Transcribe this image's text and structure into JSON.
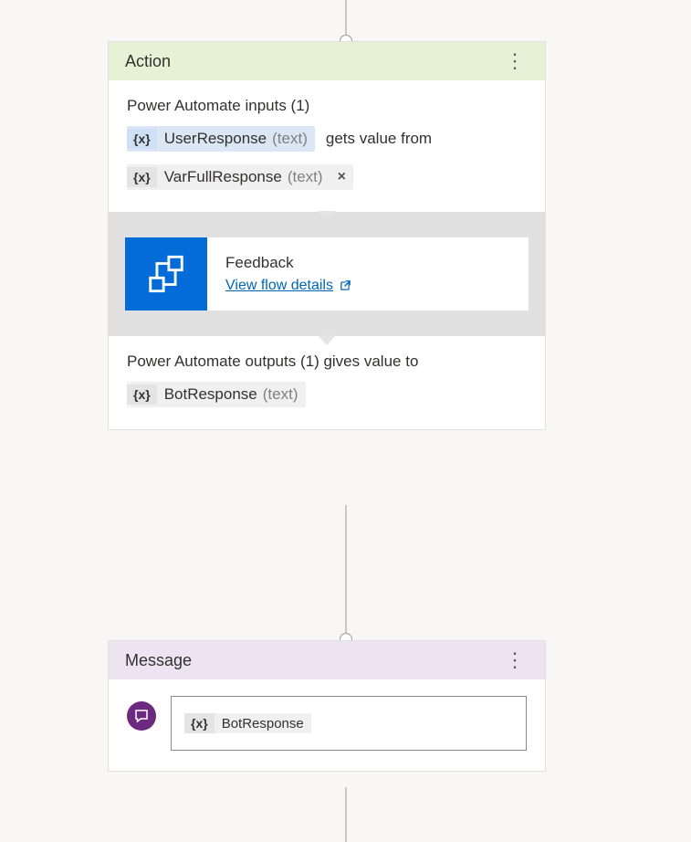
{
  "action": {
    "title": "Action",
    "inputs_heading": "Power Automate inputs (1)",
    "input_var": {
      "name": "UserResponse",
      "type": "(text)"
    },
    "bridge_text": "gets value from",
    "source_var": {
      "name": "VarFullResponse",
      "type": "(text)"
    },
    "remove_label": "×",
    "flow": {
      "name": "Feedback",
      "link_label": "View flow details"
    },
    "outputs_heading": "Power Automate outputs (1) gives value to",
    "output_var": {
      "name": "BotResponse",
      "type": "(text)"
    }
  },
  "message": {
    "title": "Message",
    "var": {
      "name": "BotResponse"
    }
  },
  "icons": {
    "var": "{x}",
    "more": "⋮",
    "external": "↗"
  }
}
